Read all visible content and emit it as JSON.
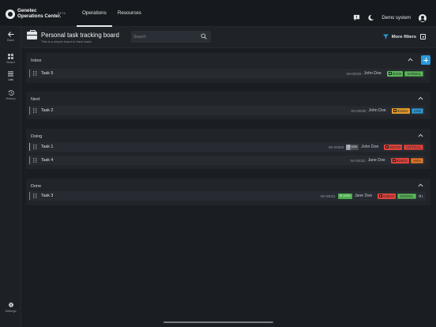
{
  "app": {
    "logo_line1": "Genetec",
    "logo_line2": "Operations Center.",
    "beta": "BETA"
  },
  "topnav": [
    {
      "label": "Operations",
      "active": true
    },
    {
      "label": "Resources",
      "active": false
    }
  ],
  "user": {
    "name": "Demo system"
  },
  "sidebar": {
    "back": "Back",
    "items": [
      {
        "label": "Board",
        "icon": "grid-icon"
      },
      {
        "label": "List",
        "icon": "list-icon"
      },
      {
        "label": "History",
        "icon": "history-icon"
      }
    ],
    "settings": "Settings"
  },
  "board": {
    "title": "Personal task tracking board",
    "subtitle": "This is a simple board to track tasks",
    "search_placeholder": "Search",
    "more_filters": "More filters"
  },
  "lanes": [
    {
      "title": "Inbox",
      "tasks": [
        {
          "name": "Task 5",
          "id": "WI-00033",
          "assignee": "John Doe",
          "due": "9/3/22",
          "due_color": "#5cb85c",
          "priority": "NORMAL",
          "priority_color": "#5cb85c",
          "bar_color": "#7b6bd6"
        }
      ]
    },
    {
      "title": "Next",
      "tasks": [
        {
          "name": "Task 2",
          "id": "WI-00030",
          "assignee": "John Doe",
          "due": "8/28/22",
          "due_color": "#e39b2a",
          "priority": "LOW",
          "priority_color": "#2d9ad3",
          "bar_color": "#45a3a8"
        }
      ]
    },
    {
      "title": "Doing",
      "tasks": [
        {
          "name": "Task 1",
          "id": "WI-00029",
          "assignee": "John Doe",
          "progress": "33%",
          "progress_fraction": 0.33,
          "progress_color": "#9aa0a6",
          "due": "8/27/22",
          "due_color": "#e0443b",
          "priority": "CRITICAL",
          "priority_color": "#e0443b",
          "bar_color": "#d6ab3c"
        },
        {
          "name": "Task 4",
          "id": "WI-00032",
          "assignee": "Jane Doe",
          "due": "8/26/22",
          "due_color": "#e0443b",
          "priority": "HIGH",
          "priority_color": "#e67b2a",
          "bar_color": "#45a3a8"
        }
      ]
    },
    {
      "title": "Done",
      "tasks": [
        {
          "name": "Task 3",
          "id": "WI-00031",
          "assignee": "Jane Doe",
          "progress": "100%",
          "progress_fraction": 1.0,
          "progress_color": "#4cae4c",
          "due": "8/25/22",
          "due_color": "#e0443b",
          "priority": "NORMAL",
          "priority_color": "#5cb85c",
          "count": "1",
          "bar_color": "#c25bc2"
        }
      ]
    }
  ]
}
